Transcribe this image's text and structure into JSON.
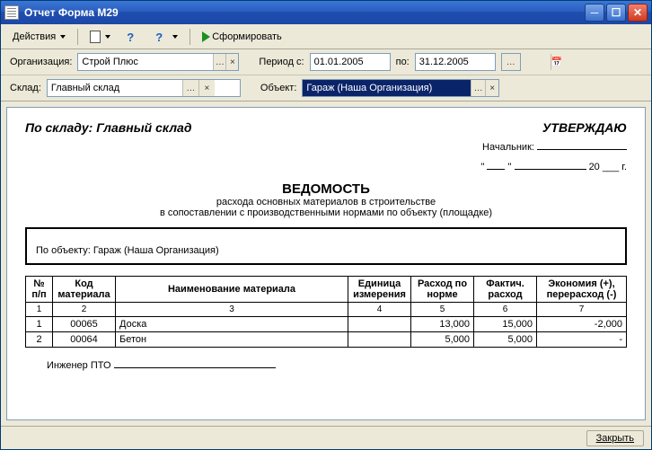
{
  "window": {
    "title": "Отчет  Форма М29"
  },
  "toolbar": {
    "actions_label": "Действия",
    "form_label": "Сформировать"
  },
  "filters": {
    "org_label": "Организация:",
    "org_value": "Строй Плюс",
    "period_label": "Период с:",
    "period_from": "01.01.2005",
    "period_to_label": "по:",
    "period_to": "31.12.2005",
    "warehouse_label": "Склад:",
    "warehouse_value": "Главный склад",
    "object_label": "Объект:",
    "object_value": "Гараж (Наша Организация)"
  },
  "report": {
    "by_warehouse": "По складу: Главный склад",
    "approve": "УТВЕРЖДАЮ",
    "chief_label": "Начальник:",
    "date_tail": "20 ___ г.",
    "title": "ВЕДОМОСТЬ",
    "subtitle1": "расхода основных материалов в строительстве",
    "subtitle2": "в сопоставлении с производственными нормами по объекту (площадке)",
    "object_box": "По объекту: Гараж (Наша Организация)",
    "engineer_label": "Инженер ПТО",
    "columns": {
      "c1": "№ п/п",
      "c2": "Код материала",
      "c3": "Наименование материала",
      "c4": "Единица измерения",
      "c5": "Расход по норме",
      "c6": "Фактич. расход",
      "c7": "Экономия (+), перерасход (-)"
    },
    "col_idx": {
      "i1": "1",
      "i2": "2",
      "i3": "3",
      "i4": "4",
      "i5": "5",
      "i6": "6",
      "i7": "7"
    },
    "rows": [
      {
        "n": "1",
        "code": "00065",
        "name": "Доска",
        "unit": "",
        "norm": "13,000",
        "fact": "15,000",
        "econ": "-2,000"
      },
      {
        "n": "2",
        "code": "00064",
        "name": "Бетон",
        "unit": "",
        "norm": "5,000",
        "fact": "5,000",
        "econ": "-"
      }
    ]
  },
  "footer": {
    "close_label": "Закрыть"
  }
}
